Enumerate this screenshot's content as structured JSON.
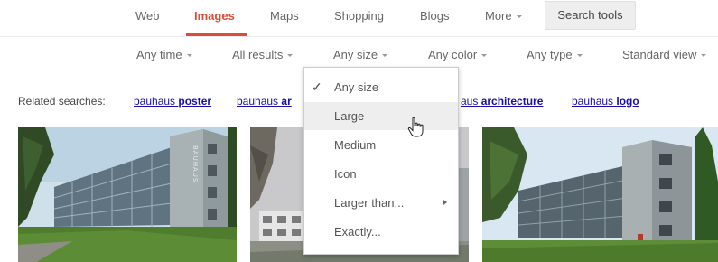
{
  "nav": {
    "tabs": [
      "Web",
      "Images",
      "Maps",
      "Shopping",
      "Blogs",
      "More"
    ],
    "active_tab": "Images",
    "search_tools_label": "Search tools"
  },
  "filters": [
    "Any time",
    "All results",
    "Any size",
    "Any color",
    "Any type",
    "Standard view"
  ],
  "related": {
    "label": "Related searches:",
    "links": [
      {
        "prefix": "bauhaus",
        "bold": "poster"
      },
      {
        "prefix": "bauhaus",
        "bold": "ar"
      },
      {
        "prefix": "aus",
        "bold": "architecture"
      },
      {
        "prefix": "bauhaus",
        "bold": "logo"
      }
    ]
  },
  "size_menu": {
    "items": [
      "Any size",
      "Large",
      "Medium",
      "Icon",
      "Larger than...",
      "Exactly..."
    ],
    "checked": "Any size",
    "hovered": "Large"
  },
  "images": {
    "building_sign": "BAUHAUS"
  },
  "colors": {
    "accent_red": "#dd4b39",
    "link_blue": "#1a0dab"
  }
}
